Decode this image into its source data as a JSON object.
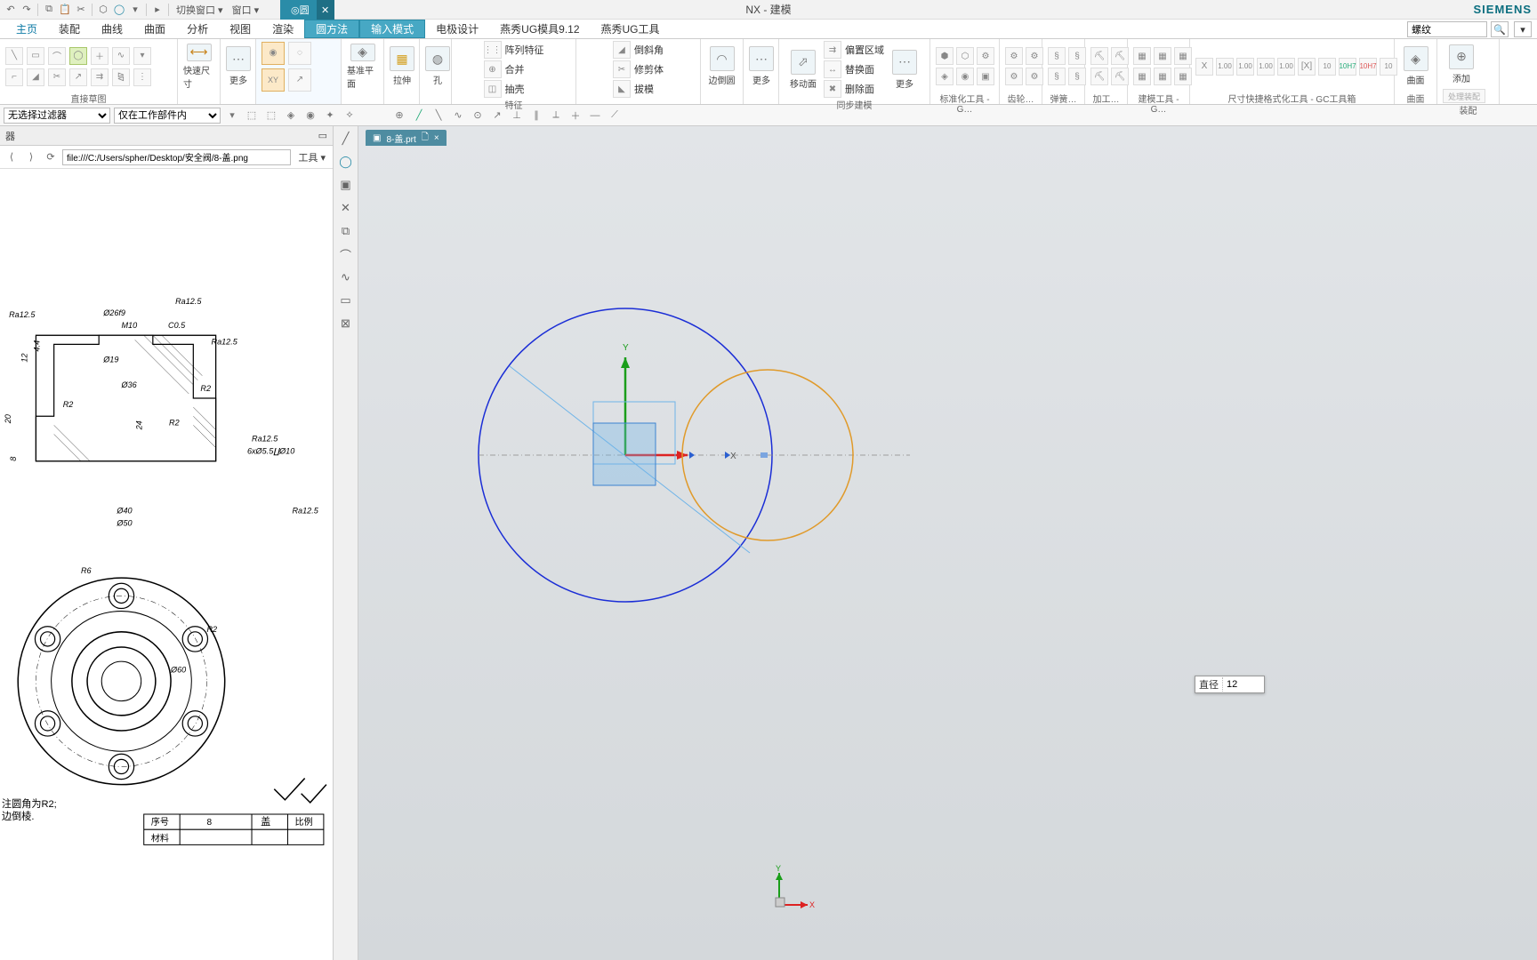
{
  "app": {
    "title": "NX - 建模",
    "brand": "SIEMENS",
    "activeDialog": "圆"
  },
  "qa": {
    "switchWindow": "切换窗口",
    "window": "窗口"
  },
  "tabs": [
    "主页",
    "装配",
    "曲线",
    "曲面",
    "分析",
    "视图",
    "渲染",
    "圆方法",
    "输入模式",
    "电极设计",
    "燕秀UG模具9.12",
    "燕秀UG工具"
  ],
  "ribbon": {
    "panels": {
      "sketch": "直接草图",
      "feature": "特征",
      "sync": "同步建模",
      "std": "标准化工具 - G…",
      "gear": "齿轮…",
      "spring": "弹簧…",
      "mfg": "加工…",
      "model": "建模工具 - G…",
      "dim": "尺寸快捷格式化工具 - GC工具箱",
      "surf": "曲面",
      "asm": "装配"
    },
    "big": {
      "quickDim": "快速尺寸",
      "more1": "更多",
      "datum": "基准平面",
      "extrude": "拉伸",
      "hole": "孔",
      "pattern": "阵列特征",
      "union": "合并",
      "shell": "抽壳",
      "edgeBlend": "边倒圆",
      "draft": "拔模",
      "more2": "更多",
      "moveFace": "移动面",
      "chamfer": "倒斜角",
      "trim": "修剪体",
      "deleteFace": "删除面",
      "replace": "替换面",
      "offsetRegion": "偏置区域",
      "more3": "更多",
      "surface": "曲面",
      "addAsm": "添加"
    },
    "xy": "XY",
    "circleGroup": {
      "method": "圆方法",
      "input": "输入模式"
    }
  },
  "filters": {
    "sel": "无选择过滤器",
    "scope": "仅在工作部件内"
  },
  "left": {
    "headerMenu": "器",
    "tools": "工具",
    "path": "file:///C:/Users/spher/Desktop/安全阀/8-盖.png",
    "annotations": {
      "ra125": "Ra12.5",
      "d26": "Ø26f9",
      "m10": "M10",
      "c05": "C0.5",
      "d19": "Ø19",
      "d36": "Ø36",
      "r2": "R2",
      "h20": "20",
      "h12": "12",
      "h44": "4.4",
      "h24": "24",
      "h8": "8",
      "d40": "Ø40",
      "d50": "Ø50",
      "bolt": "6xØ5.5∐Ø10",
      "r6": "R6",
      "d60": "Ø60",
      "note1": "注圆角为R2;",
      "note2": "边倒棱."
    },
    "titleblock": {
      "seq": "序号",
      "seqv": "8",
      "part": "盖",
      "scale": "比例",
      "mat": "材料"
    }
  },
  "canvas": {
    "fileTab": "8-盖.prt",
    "xLabel": "X",
    "yLabel": "Y",
    "dimPrefix": "直径",
    "dimValue": "12"
  },
  "search": {
    "placeholder": "螺纹"
  }
}
